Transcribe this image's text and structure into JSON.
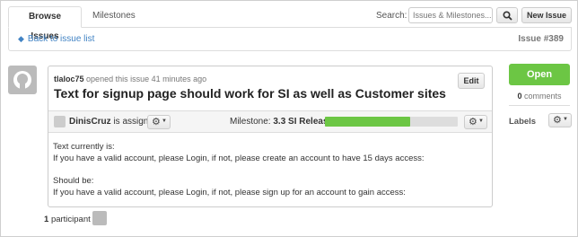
{
  "tabs": {
    "browse": "Browse Issues",
    "milestones": "Milestones"
  },
  "search": {
    "label": "Search:",
    "placeholder": "Issues & Milestones..."
  },
  "new_issue_label": "New Issue",
  "breadcrumb": {
    "back_label": "Back to issue list",
    "issue_number": "Issue #389"
  },
  "issue": {
    "author": "tlaloc75",
    "opened_text": "opened this issue 41 minutes ago",
    "title": "Text for signup page should work for SI as well as Customer sites",
    "edit_label": "Edit",
    "assignee": "DinisCruz",
    "assigned_text": "is assigned",
    "milestone_label": "Milestone:",
    "milestone_name": "3.3 SI Release",
    "milestone_progress": 0.64,
    "body": [
      "Text currently is:",
      "If you have a valid account, please Login, if not, please create an account to have 15 days access:",
      "Should be:",
      "If you have a valid account, please Login, if not, please sign up for an account to gain access:"
    ]
  },
  "participants": {
    "count": "1",
    "label": "participant"
  },
  "sidebar": {
    "status_button": "Open",
    "comment_count": "0",
    "comment_label": "comments",
    "labels_heading": "Labels"
  },
  "colors": {
    "open_green": "#6cc644",
    "link_blue": "#4183c4"
  }
}
